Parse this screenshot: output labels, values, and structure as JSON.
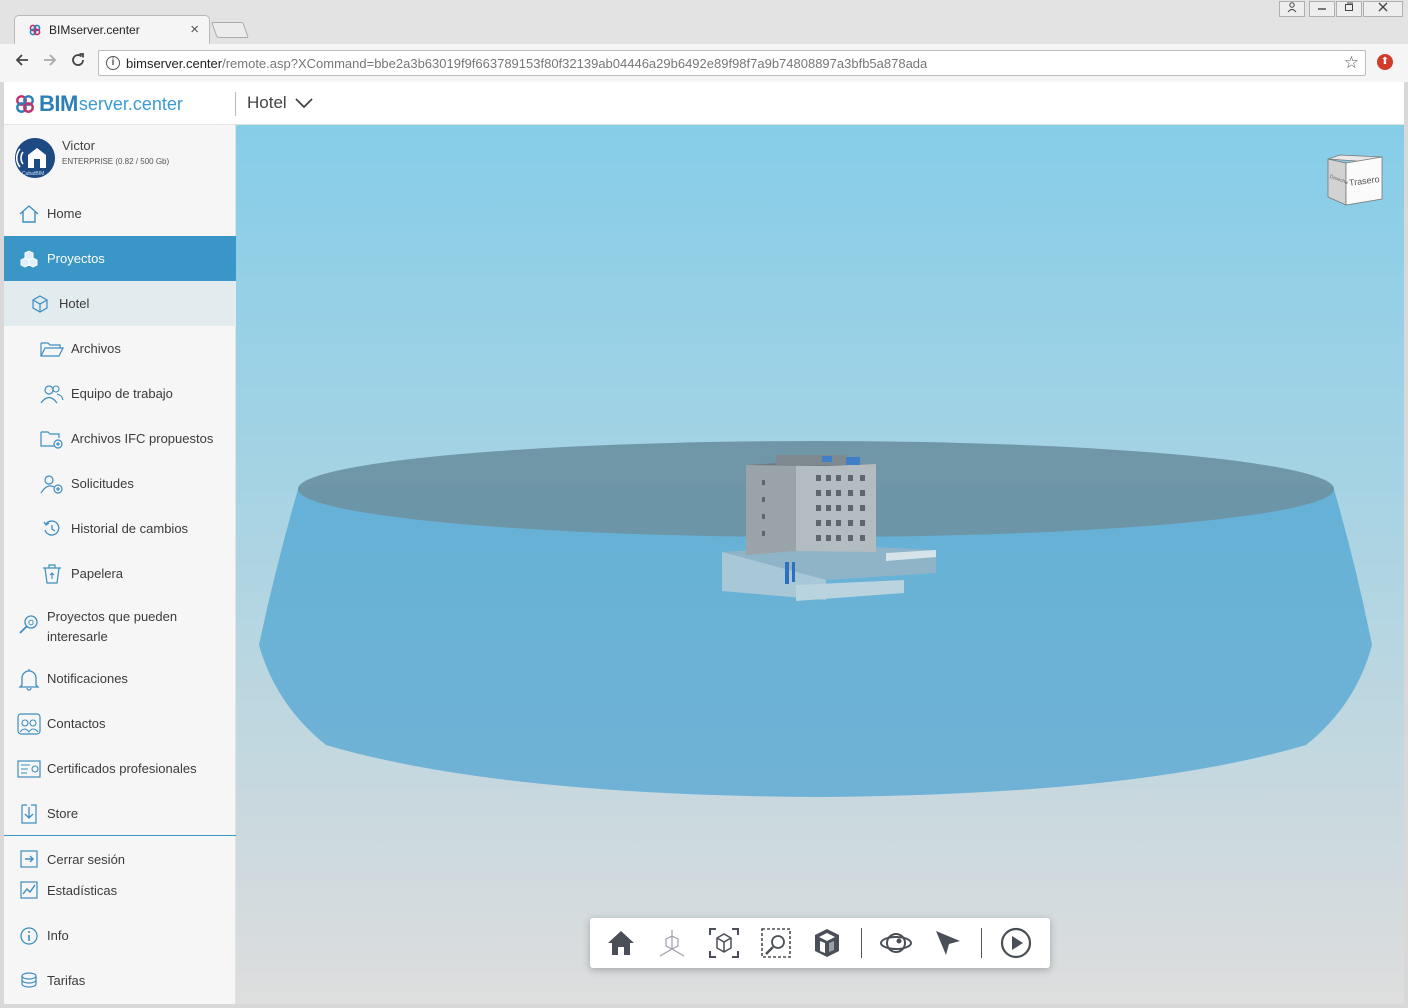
{
  "browser": {
    "tab_title": "BIMserver.center",
    "tab_close": "×",
    "url_host": "bimserver.center",
    "url_path": "/remote.asp?XCommand=bbe2a3b63019f9f663789153f80f32139ab04446a29b6492e89f98f7a9b74808897a3bfb5a878ada",
    "window_buttons": [
      "person-icon",
      "minimize-icon",
      "restore-icon",
      "close-icon"
    ]
  },
  "header": {
    "logo_bim": "BIM",
    "logo_rest": "server.center",
    "project_name": "Hotel"
  },
  "user": {
    "name": "Victor",
    "plan": "ENTERPRISE (0.82 / 500 Gb)",
    "avatar_caption": "CubatBIM"
  },
  "sidebar": {
    "home": "Home",
    "projects": "Proyectos",
    "hotel": "Hotel",
    "files": "Archivos",
    "team": "Equipo de trabajo",
    "ifc_proposed": "Archivos IFC propuestos",
    "requests": "Solicitudes",
    "history": "Historial de cambios",
    "trash": "Papelera",
    "interesting_projects": "Proyectos que pueden interesarle",
    "notifications": "Notificaciones",
    "contacts": "Contactos",
    "certificates": "Certificados profesionales",
    "store": "Store",
    "logout": "Cerrar sesión",
    "stats": "Estadísticas",
    "info": "Info",
    "rates": "Tarifas"
  },
  "viewer": {
    "navcube_front": "Trasero",
    "navcube_side": "Derecha",
    "tools": [
      "home-view-icon",
      "axes-icon",
      "zoom-extents-icon",
      "zoom-window-icon",
      "section-box-icon",
      "orbit-icon",
      "select-pointer-icon",
      "play-icon"
    ],
    "colors": {
      "accent": "#3996c6",
      "sky_top": "#86cde8",
      "ground": "#dedede"
    }
  }
}
